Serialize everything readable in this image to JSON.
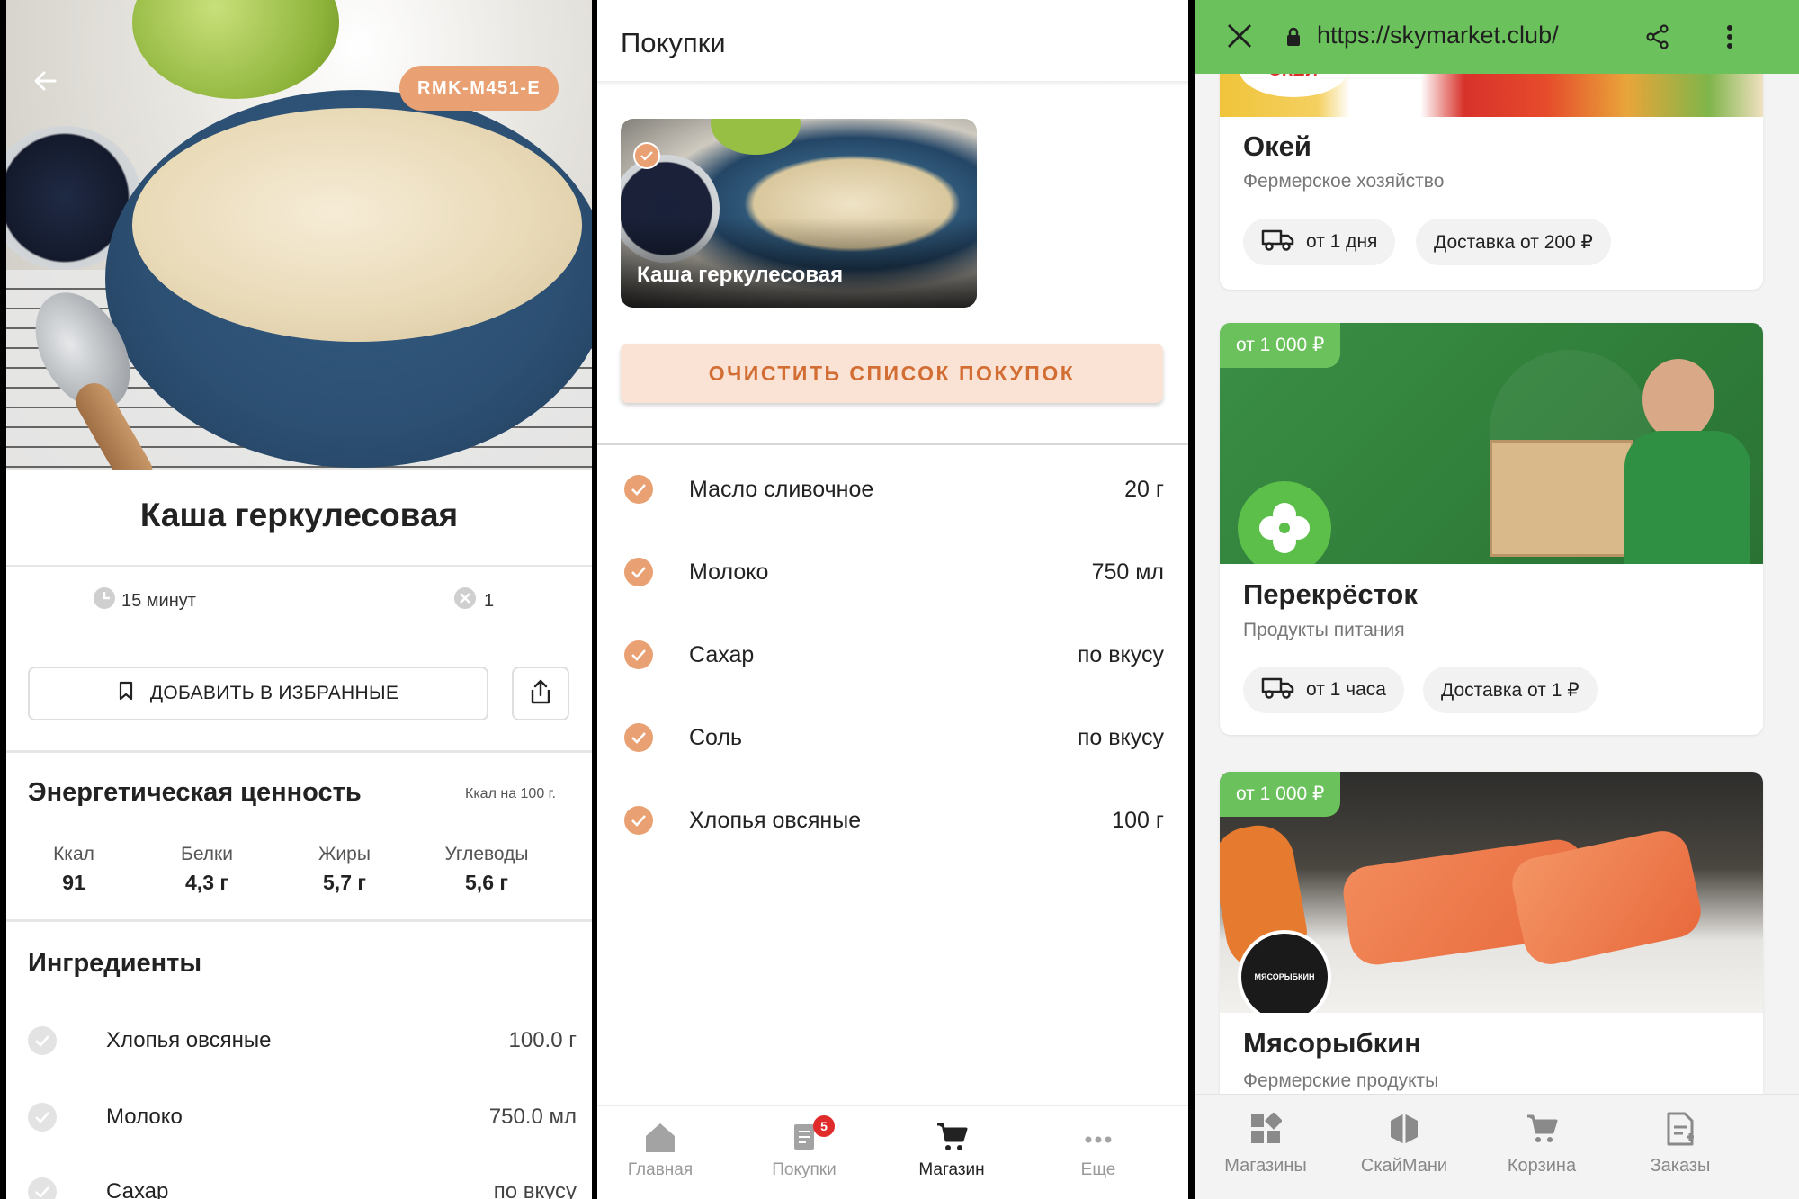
{
  "recipe": {
    "code": "RMK-M451-E",
    "title": "Каша геркулесовая",
    "time": "15 минут",
    "servings": "1",
    "favorite_label": "ДОБАВИТЬ В ИЗБРАННЫЕ",
    "energy_title": "Энергетическая ценность",
    "energy_unit": "Ккал на 100 г.",
    "nutrition": [
      {
        "label": "Ккал",
        "value": "91"
      },
      {
        "label": "Белки",
        "value": "4,3 г"
      },
      {
        "label": "Жиры",
        "value": "5,7 г"
      },
      {
        "label": "Углеводы",
        "value": "5,6 г"
      }
    ],
    "ingredients_title": "Ингредиенты",
    "ingredients": [
      {
        "name": "Хлопья овсяные",
        "qty": "100.0 г"
      },
      {
        "name": "Молоко",
        "qty": "750.0 мл"
      },
      {
        "name": "Сахар",
        "qty": "по вкусу"
      }
    ]
  },
  "shopping": {
    "title": "Покупки",
    "card_caption": "Каша геркулесовая",
    "clear_label": "ОЧИСТИТЬ СПИСОК ПОКУПОК",
    "items": [
      {
        "name": "Масло сливочное",
        "qty": "20 г"
      },
      {
        "name": "Молоко",
        "qty": "750 мл"
      },
      {
        "name": "Сахар",
        "qty": "по вкусу"
      },
      {
        "name": "Соль",
        "qty": "по вкусу"
      },
      {
        "name": "Хлопья овсяные",
        "qty": "100 г"
      }
    ],
    "nav": [
      {
        "label": "Главная",
        "icon": "home-icon"
      },
      {
        "label": "Покупки",
        "icon": "receipt-icon",
        "badge": "5"
      },
      {
        "label": "Магазин",
        "icon": "cart-icon",
        "active": true
      },
      {
        "label": "Еще",
        "icon": "more-horizontal-icon"
      }
    ]
  },
  "browser": {
    "url": "https://skymarket.club/",
    "stores": [
      {
        "name": "Окей",
        "subtitle": "Фермерское хозяйство",
        "logo_text": "ОКЕЙ",
        "delivery_time": "от 1 дня",
        "delivery_price": "Доставка от 200 ₽"
      },
      {
        "name": "Перекрёсток",
        "subtitle": "Продукты питания",
        "min_order": "от 1 000 ₽",
        "delivery_time": "от 1 часа",
        "delivery_price": "Доставка от 1 ₽"
      },
      {
        "name": "Мясорыбкин",
        "subtitle": "Фермерские продукты",
        "min_order": "от 1 000 ₽",
        "logo_text": "МЯСОРЫБКИН"
      }
    ],
    "nav": [
      {
        "label": "Магазины",
        "icon": "stores-icon"
      },
      {
        "label": "СкайМани",
        "icon": "skymoney-icon"
      },
      {
        "label": "Корзина",
        "icon": "cart-icon"
      },
      {
        "label": "Заказы",
        "icon": "orders-icon"
      }
    ]
  },
  "colors": {
    "accent": "#e9a173",
    "brand_green": "#6bc25c",
    "badge_red": "#e02b2b"
  }
}
